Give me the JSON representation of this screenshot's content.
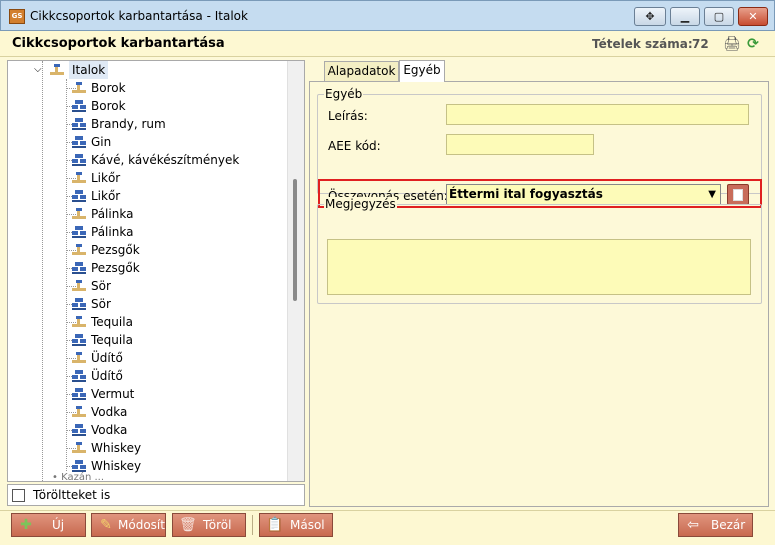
{
  "window": {
    "title": "Cikkcsoportok karbantartása - Italok",
    "app_icon_text": "GS",
    "buttons": [
      "move",
      "minimize",
      "maximize",
      "close"
    ]
  },
  "header": {
    "title": "Cikkcsoportok karbantartása",
    "count_label": "Tételek száma:",
    "count_value": "72",
    "icons": [
      "print-icon",
      "refresh-icon"
    ]
  },
  "tree": {
    "root": {
      "label": "Italok",
      "expanded": true
    },
    "items": [
      {
        "label": "Borok",
        "icon": "hierarchy"
      },
      {
        "label": "Borok",
        "icon": "stack"
      },
      {
        "label": "Brandy, rum",
        "icon": "stack"
      },
      {
        "label": "Gin",
        "icon": "stack"
      },
      {
        "label": "Kávé, kávékészítmények",
        "icon": "stack"
      },
      {
        "label": "Likőr",
        "icon": "hierarchy"
      },
      {
        "label": "Likőr",
        "icon": "stack"
      },
      {
        "label": "Pálinka",
        "icon": "hierarchy"
      },
      {
        "label": "Pálinka",
        "icon": "stack"
      },
      {
        "label": "Pezsgők",
        "icon": "hierarchy"
      },
      {
        "label": "Pezsgők",
        "icon": "stack"
      },
      {
        "label": "Sör",
        "icon": "hierarchy"
      },
      {
        "label": "Sör",
        "icon": "stack"
      },
      {
        "label": "Tequila",
        "icon": "hierarchy"
      },
      {
        "label": "Tequila",
        "icon": "stack"
      },
      {
        "label": "Üdítő",
        "icon": "hierarchy"
      },
      {
        "label": "Üdítő",
        "icon": "stack"
      },
      {
        "label": "Vermut",
        "icon": "stack"
      },
      {
        "label": "Vodka",
        "icon": "hierarchy"
      },
      {
        "label": "Vodka",
        "icon": "stack"
      },
      {
        "label": "Whiskey",
        "icon": "hierarchy"
      },
      {
        "label": "Whiskey",
        "icon": "stack"
      }
    ]
  },
  "deleted_checkbox": {
    "label": "Töröltteket is",
    "checked": false
  },
  "tabs": [
    {
      "label": "Alapadatok",
      "active": false
    },
    {
      "label": "Egyéb",
      "active": true
    }
  ],
  "form": {
    "group_title": "Egyéb",
    "leiras_label": "Leírás:",
    "leiras_value": "",
    "aee_label": "AEE kód:",
    "aee_value": "",
    "merge_label": "Összevonás esetén:",
    "merge_value": "Éttermi ital fogyasztás",
    "notes_title": "Megjegyzés",
    "notes_value": ""
  },
  "toolbar": {
    "new_label": "Új",
    "edit_label": "Módosít",
    "delete_label": "Töröl",
    "copy_label": "Másol",
    "close_label": "Bezár"
  },
  "colors": {
    "field_bg": "#fdfbb8",
    "button_bg": "#c8694f",
    "highlight_border": "#e02020",
    "panel_bg": "#fdf9d8"
  }
}
